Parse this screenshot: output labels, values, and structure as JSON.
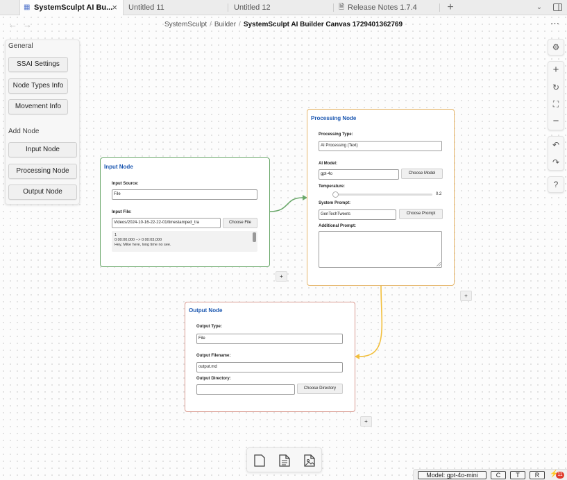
{
  "tabs": [
    {
      "label": "SystemSculpt AI Bu..."
    },
    {
      "label": "Untitled 11"
    },
    {
      "label": "Untitled 12"
    },
    {
      "label": "Release Notes 1.7.4"
    }
  ],
  "breadcrumb": {
    "part1": "SystemSculpt",
    "part2": "Builder",
    "current": "SystemSculpt AI Builder Canvas 1729401362769",
    "separator": "/"
  },
  "left_panel": {
    "general_heading": "General",
    "general_buttons": [
      "SSAI Settings",
      "Node Types Info",
      "Movement Info"
    ],
    "add_node_heading": "Add Node",
    "add_buttons": [
      "Input Node",
      "Processing Node",
      "Output Node"
    ]
  },
  "input_node": {
    "title": "Input Node",
    "source_label": "Input Source:",
    "source_value": "File",
    "file_label": "Input File:",
    "file_value": "Videos/2024-10-16-22-22-01/timestamped_tra",
    "choose_file": "Choose File",
    "preview": [
      "1",
      "0:00:00,000 --> 0:00:03,000",
      "Hey, Mike here, long time no see."
    ]
  },
  "processing_node": {
    "title": "Processing Node",
    "type_label": "Processing Type:",
    "type_value": "AI Processing (Text)",
    "model_label": "AI Model:",
    "model_value": "gpt-4o",
    "choose_model": "Choose Model",
    "temp_label": "Temperature:",
    "temp_value": "0.2",
    "prompt_label": "System Prompt:",
    "prompt_value": "GenTechTweets",
    "choose_prompt": "Choose Prompt",
    "additional_label": "Additional Prompt:"
  },
  "output_node": {
    "title": "Output Node",
    "type_label": "Output Type:",
    "type_value": "File",
    "filename_label": "Output Filename:",
    "filename_value": "output.md",
    "dir_label": "Output Directory:",
    "dir_value": "",
    "choose_dir": "Choose Directory"
  },
  "handles": {
    "plus": "+"
  },
  "status_bar": {
    "model": "Model: gpt-4o-mini",
    "c": "C",
    "t": "T",
    "r": "R",
    "badge": "11"
  },
  "colors": {
    "input_border": "#6aa86a",
    "processing_border": "#e5b56a",
    "output_border": "#d99a90",
    "title_blue": "#1a56b0",
    "edge_green": "#6aa86a",
    "edge_yellow": "#f2bf3d"
  },
  "icons": [
    "canvas-icon",
    "close-icon",
    "file-icon",
    "plus-icon",
    "chevron-down-icon",
    "sidebar-toggle-icon",
    "back-arrow-icon",
    "forward-arrow-icon",
    "more-icon",
    "settings-icon",
    "zoom-in-icon",
    "reset-icon",
    "fit-icon",
    "zoom-out-icon",
    "undo-icon",
    "redo-icon",
    "help-icon",
    "new-note-icon",
    "new-doc-icon",
    "new-media-icon",
    "plugin-icon"
  ]
}
